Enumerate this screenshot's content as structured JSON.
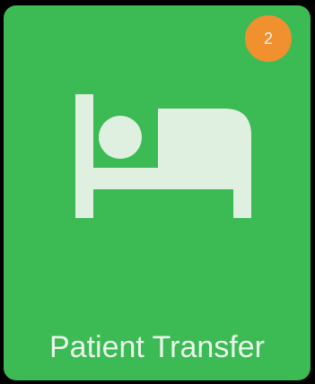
{
  "tile": {
    "label": "Patient Transfer",
    "icon": "bed-icon",
    "badge_count": "2",
    "colors": {
      "background": "#3cba54",
      "badge": "#f0902e",
      "icon": "#dff0e0",
      "text": "#eaf6ec"
    }
  }
}
